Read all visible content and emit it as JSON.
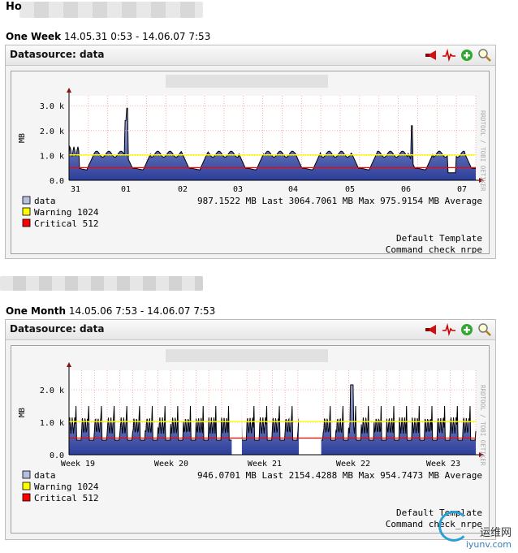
{
  "host": {
    "title": "Ho"
  },
  "panels": [
    {
      "period_label": "One Week",
      "period_range": "14.05.31 0:53 - 14.06.07 7:53",
      "datasource_title": "Datasource: data",
      "graph": {
        "ylabel": "MB",
        "yticks": [
          "3.0 k",
          "2.0 k",
          "1.0 k",
          "0.0"
        ],
        "yvalues": [
          3000,
          2000,
          1000,
          0
        ],
        "ymax": 3400,
        "xticks": [
          "31",
          "01",
          "02",
          "03",
          "04",
          "05",
          "06",
          "07"
        ],
        "rrd_label": "RRDTOOL / TOBI OETIKER",
        "legend": [
          {
            "name": "data",
            "color": "#b7bfe0",
            "stats": "987.1522  MB Last   3064.7061  MB Max   975.9154  MB Average"
          },
          {
            "name": "Warning  1024",
            "color": "#ffff00"
          },
          {
            "name": "Critical 512",
            "color": "#ff0000"
          }
        ],
        "template": "Default Template",
        "command": "Command check_nrpe"
      }
    },
    {
      "period_label": "One Month",
      "period_range": "14.05.06 7:53 - 14.06.07 7:53",
      "datasource_title": "Datasource: data",
      "graph": {
        "ylabel": "MB",
        "yticks": [
          "2.0 k",
          "1.0 k",
          "0.0"
        ],
        "yvalues": [
          2000,
          1000,
          0
        ],
        "ymax": 2600,
        "xticks": [
          "Week 19",
          "Week 20",
          "Week 21",
          "Week 22",
          "Week 23"
        ],
        "rrd_label": "RRDTOOL / TOBI OETIKER",
        "legend": [
          {
            "name": "data",
            "color": "#b7bfe0",
            "stats": "946.0701  MB Last   2154.4288  MB Max   954.7473  MB Average"
          },
          {
            "name": "Warning  1024",
            "color": "#ffff00"
          },
          {
            "name": "Critical 512",
            "color": "#ff0000"
          }
        ],
        "template": "Default Template",
        "command": "Command check_nrpe"
      }
    }
  ],
  "chart_data": [
    {
      "type": "area",
      "title": "",
      "ylabel": "MB",
      "ylim": [
        0,
        3400
      ],
      "xtick_labels": [
        "31",
        "01",
        "02",
        "03",
        "04",
        "05",
        "06",
        "07"
      ],
      "series": [
        {
          "name": "data",
          "last": 987.1522,
          "max": 3064.7061,
          "average": 975.9154
        }
      ],
      "thresholds": {
        "warning": 1024,
        "critical": 512
      },
      "daily_baseline_min": 400,
      "daily_plateau": 1100
    },
    {
      "type": "area",
      "title": "",
      "ylabel": "MB",
      "ylim": [
        0,
        2600
      ],
      "xtick_labels": [
        "Week 19",
        "Week 20",
        "Week 21",
        "Week 22",
        "Week 23"
      ],
      "series": [
        {
          "name": "data",
          "last": 946.0701,
          "max": 2154.4288,
          "average": 954.7473
        }
      ],
      "thresholds": {
        "warning": 1024,
        "critical": 512
      }
    }
  ],
  "watermark": {
    "text": "iyunv.com",
    "brand": "运维网"
  },
  "colors": {
    "area_top": "#a8b4dc",
    "area_bottom": "#2c3e9a",
    "warning": "#ffff00",
    "critical": "#ff0000",
    "grid": "#ff9999",
    "line": "#000000"
  }
}
